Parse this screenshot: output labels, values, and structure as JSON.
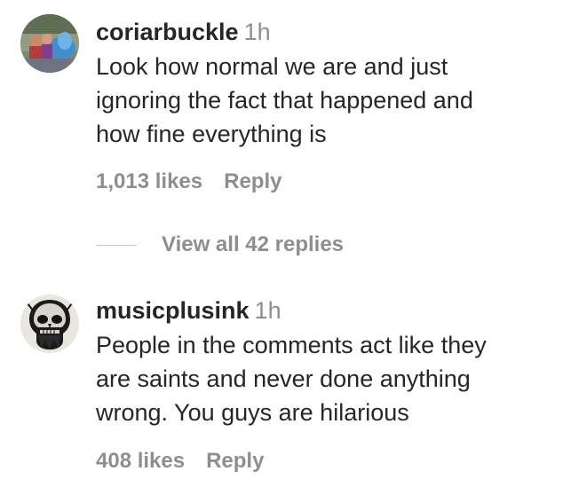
{
  "comments": [
    {
      "username": "coriarbuckle",
      "time": "1h",
      "lines": [
        "Look how normal we are and just",
        "ignoring the fact that happened and",
        "how fine everything is"
      ],
      "likes": "1,013 likes",
      "reply": "Reply",
      "avatar_icon": "profile-photo-icon"
    },
    {
      "username": "musicplusink",
      "time": "1h",
      "lines": [
        "People in the comments act like they",
        "are saints and never done anything",
        "wrong. You guys are hilarious"
      ],
      "likes": "408 likes",
      "reply": "Reply",
      "avatar_icon": "skull-avatar-icon"
    }
  ],
  "view_replies": "View all 42 replies",
  "colors": {
    "primary_text": "#262626",
    "secondary_text": "#8e8e8e",
    "divider": "#c7c7c7"
  }
}
